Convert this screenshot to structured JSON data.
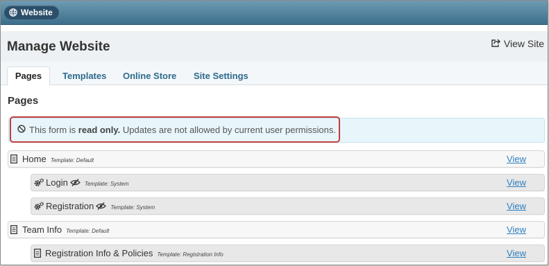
{
  "topbar": {
    "site_label": "Website"
  },
  "header": {
    "title": "Manage Website",
    "view_site_label": "View Site"
  },
  "tabs": [
    {
      "label": "Pages",
      "active": true
    },
    {
      "label": "Templates",
      "active": false
    },
    {
      "label": "Online Store",
      "active": false
    },
    {
      "label": "Site Settings",
      "active": false
    }
  ],
  "section": {
    "title": "Pages"
  },
  "alert": {
    "prefix": "This form is ",
    "bold": "read only.",
    "suffix": " Updates are not allowed by current user permissions."
  },
  "pages": [
    {
      "name": "Home",
      "template": "Template: Default",
      "view": "View",
      "level": 0,
      "icon": "page-icon",
      "hidden": false
    },
    {
      "name": "Login",
      "template": "Template: System",
      "view": "View",
      "level": 1,
      "icon": "gears-icon",
      "hidden": true
    },
    {
      "name": "Registration",
      "template": "Template: System",
      "view": "View",
      "level": 1,
      "icon": "gears-icon",
      "hidden": true
    },
    {
      "name": "Team Info",
      "template": "Template: Default",
      "view": "View",
      "level": 0,
      "icon": "page-icon",
      "hidden": false
    },
    {
      "name": "Registration Info & Policies",
      "template": "Template: Registration Info",
      "view": "View",
      "level": 1,
      "icon": "page-icon",
      "hidden": false
    }
  ],
  "colors": {
    "topbar": "#3d6f8b",
    "link": "#2d7fbf",
    "alert_bg": "#e8f5fa",
    "highlight": "#c33d3d"
  }
}
